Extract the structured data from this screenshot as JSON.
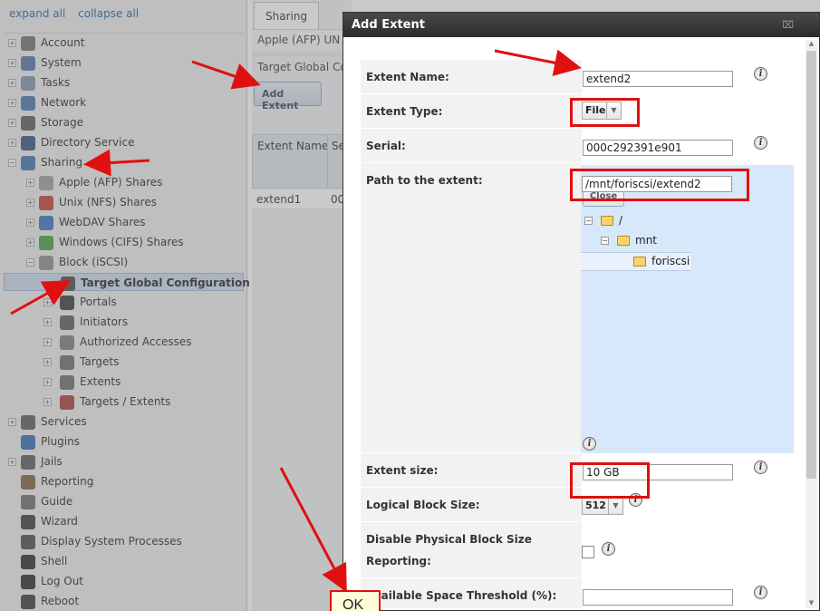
{
  "left_panel": {
    "expand_all": "expand all",
    "collapse_all": "collapse all",
    "tree": [
      {
        "label": "Account",
        "level": 0,
        "toggle": "+",
        "icon": "account-icon",
        "color": "#6a6a6a"
      },
      {
        "label": "System",
        "level": 0,
        "toggle": "+",
        "icon": "system-icon",
        "color": "#4a6ea8"
      },
      {
        "label": "Tasks",
        "level": 0,
        "toggle": "+",
        "icon": "tasks-icon",
        "color": "#7b8fa6"
      },
      {
        "label": "Network",
        "level": 0,
        "toggle": "+",
        "icon": "network-icon",
        "color": "#3f6fb0"
      },
      {
        "label": "Storage",
        "level": 0,
        "toggle": "+",
        "icon": "storage-icon",
        "color": "#555555"
      },
      {
        "label": "Directory Service",
        "level": 0,
        "toggle": "+",
        "icon": "directory-icon",
        "color": "#2b4a7c"
      },
      {
        "label": "Sharing",
        "level": 0,
        "toggle": "-",
        "icon": "sharing-icon",
        "color": "#3a6fa8"
      },
      {
        "label": "Apple (AFP) Shares",
        "level": 1,
        "toggle": "+",
        "icon": "apple-icon",
        "color": "#999999"
      },
      {
        "label": "Unix (NFS) Shares",
        "level": 1,
        "toggle": "+",
        "icon": "unix-icon",
        "color": "#c0392b"
      },
      {
        "label": "WebDAV Shares",
        "level": 1,
        "toggle": "+",
        "icon": "webdav-icon",
        "color": "#2e6fc4"
      },
      {
        "label": "Windows (CIFS) Shares",
        "level": 1,
        "toggle": "+",
        "icon": "windows-icon",
        "color": "#3d9b3d"
      },
      {
        "label": "Block (iSCSI)",
        "level": 1,
        "toggle": "-",
        "icon": "block-icon",
        "color": "#888888"
      },
      {
        "label": "Target Global Configuration",
        "level": 2,
        "toggle": "",
        "icon": "wrench-icon",
        "color": "#444444",
        "selected": true
      },
      {
        "label": "Portals",
        "level": 2,
        "toggle": "+",
        "icon": "portal-icon",
        "color": "#333333"
      },
      {
        "label": "Initiators",
        "level": 2,
        "toggle": "+",
        "icon": "initiator-icon",
        "color": "#555555"
      },
      {
        "label": "Authorized Accesses",
        "level": 2,
        "toggle": "+",
        "icon": "lock-icon",
        "color": "#777777"
      },
      {
        "label": "Targets",
        "level": 2,
        "toggle": "+",
        "icon": "target-icon",
        "color": "#666666"
      },
      {
        "label": "Extents",
        "level": 2,
        "toggle": "+",
        "icon": "extent-icon",
        "color": "#666666"
      },
      {
        "label": "Targets / Extents",
        "level": 2,
        "toggle": "+",
        "icon": "target-extent-icon",
        "color": "#a33"
      },
      {
        "label": "Services",
        "level": 0,
        "toggle": "+",
        "icon": "services-icon",
        "color": "#555555"
      },
      {
        "label": "Plugins",
        "level": 0,
        "toggle": "",
        "icon": "plugins-icon",
        "color": "#2b63b5"
      },
      {
        "label": "Jails",
        "level": 0,
        "toggle": "+",
        "icon": "jails-icon",
        "color": "#555555"
      },
      {
        "label": "Reporting",
        "level": 0,
        "toggle": "",
        "icon": "reporting-icon",
        "color": "#7a5a3a"
      },
      {
        "label": "Guide",
        "level": 0,
        "toggle": "",
        "icon": "guide-icon",
        "color": "#666666"
      },
      {
        "label": "Wizard",
        "level": 0,
        "toggle": "",
        "icon": "wizard-icon",
        "color": "#333333"
      },
      {
        "label": "Display System Processes",
        "level": 0,
        "toggle": "",
        "icon": "processes-icon",
        "color": "#444444"
      },
      {
        "label": "Shell",
        "level": 0,
        "toggle": "",
        "icon": "shell-icon",
        "color": "#222222"
      },
      {
        "label": "Log Out",
        "level": 0,
        "toggle": "",
        "icon": "logout-icon",
        "color": "#222222"
      },
      {
        "label": "Reboot",
        "level": 0,
        "toggle": "",
        "icon": "reboot-icon",
        "color": "#333333"
      }
    ]
  },
  "middle": {
    "tab": "Sharing",
    "row1": "Apple (AFP)  UN",
    "row2": "Target Global Co",
    "add_button": "Add Extent",
    "col1": "Extent Name",
    "col2": "Se",
    "cell1": "extend1",
    "cell2": "00"
  },
  "dialog": {
    "title": "Add Extent",
    "close": "⌧",
    "fields": {
      "extent_name": {
        "label": "Extent Name:",
        "value": "extend2"
      },
      "extent_type": {
        "label": "Extent Type:",
        "value": "File"
      },
      "serial": {
        "label": "Serial:",
        "value": "000c292391e901"
      },
      "path": {
        "label": "Path to the extent:",
        "value": "/mnt/foriscsi/extend2"
      },
      "extent_size": {
        "label": "Extent size:",
        "value": "10 GB"
      },
      "logical_block": {
        "label": "Logical Block Size:",
        "value": "512"
      },
      "disable_physical": {
        "label_line1": "Disable Physical Block Size",
        "label_line2": "Reporting:"
      },
      "threshold": {
        "label": "Available Space Threshold (%):",
        "value": ""
      }
    },
    "browser": {
      "close_label": "Close",
      "root": "/",
      "mnt": "mnt",
      "foriscsi": "foriscsi"
    }
  },
  "annotation": {
    "ok_label": "OK",
    "highlight_color": "#e01010"
  }
}
